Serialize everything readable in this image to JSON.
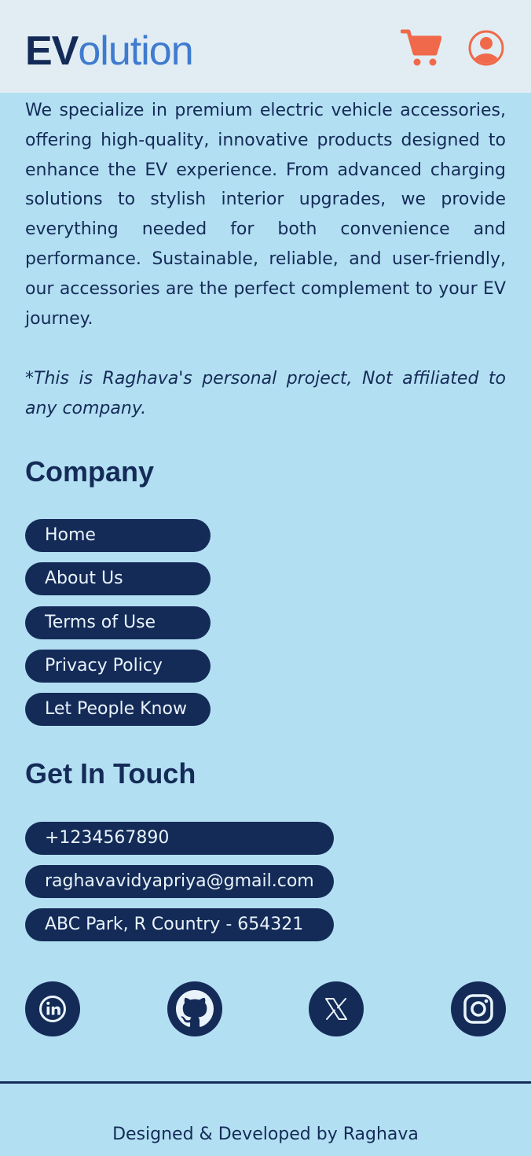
{
  "header": {
    "logo_strong": "EV",
    "logo_rest": "olution",
    "cart_icon": "shopping-cart-icon",
    "user_icon": "user-account-icon"
  },
  "about": {
    "description": "We specialize in premium electric vehicle accessories, offering high-quality, innovative products designed to enhance the EV experience. From advanced charging solutions to stylish interior upgrades, we provide everything needed for both convenience and performance. Sustainable, reliable, and user-friendly, our accessories are the perfect complement to your EV journey.",
    "disclaimer": "*This is Raghava's personal project, Not affiliated to any company."
  },
  "company": {
    "title": "Company",
    "links": [
      "Home",
      "About Us",
      "Terms of Use",
      "Privacy Policy",
      "Let People Know"
    ]
  },
  "contact": {
    "title": "Get In Touch",
    "phone": "+1234567890",
    "email": "raghavavidyapriya@gmail.com",
    "address": "ABC Park, R Country - 654321"
  },
  "social": {
    "icons": [
      "linkedin-icon",
      "github-icon",
      "x-twitter-icon",
      "instagram-icon"
    ]
  },
  "footer": {
    "credit": "Designed & Developed by Raghava"
  },
  "colors": {
    "navy": "#142b58",
    "accent_orange": "#f0694b",
    "logo_blue": "#3f7bcf",
    "background": "#b3dff2",
    "header_bg": "#e1edf3"
  }
}
